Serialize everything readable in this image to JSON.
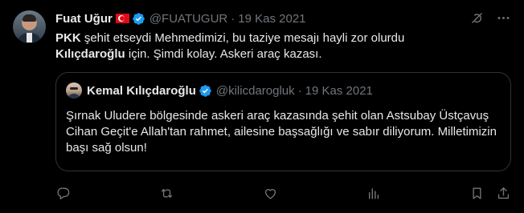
{
  "tweet": {
    "author_name": "Fuat Uğur",
    "author_flag": "turkey-flag-emoji",
    "verified": true,
    "handle": "@FUATUGUR",
    "separator": "·",
    "date": "19 Kas 2021",
    "text_part1_bold": "PKK",
    "text_part2": " şehit etseydi Mehmedimizi, bu taziye mesajı hayli zor olurdu",
    "text_part3_bold": "Kılıçdaroğlu",
    "text_part4": " için. Şimdi kolay. Askeri araç kazası."
  },
  "quoted_tweet": {
    "author_name": "Kemal Kılıçdaroğlu",
    "verified": true,
    "handle": "@kilicdarogluk",
    "separator": "·",
    "date": "19 Kas 2021",
    "text": "Şırnak Uludere bölgesinde askeri araç kazasında şehit olan Astsubay Üstçavuş Cihan Geçit'e Allah'tan rahmet, ailesine başsağlığı ve sabır diliyorum. Milletimizin başı sağ olsun!"
  },
  "icons": {
    "top": [
      "grok-icon",
      "more-icon"
    ],
    "actions": [
      "reply-icon",
      "retweet-icon",
      "like-icon",
      "views-icon",
      "bookmark-icon",
      "share-icon"
    ]
  },
  "colors": {
    "background": "#000000",
    "text": "#e7e9ea",
    "muted": "#71767b",
    "verified_blue": "#1d9bf0",
    "border": "#2f3336"
  }
}
